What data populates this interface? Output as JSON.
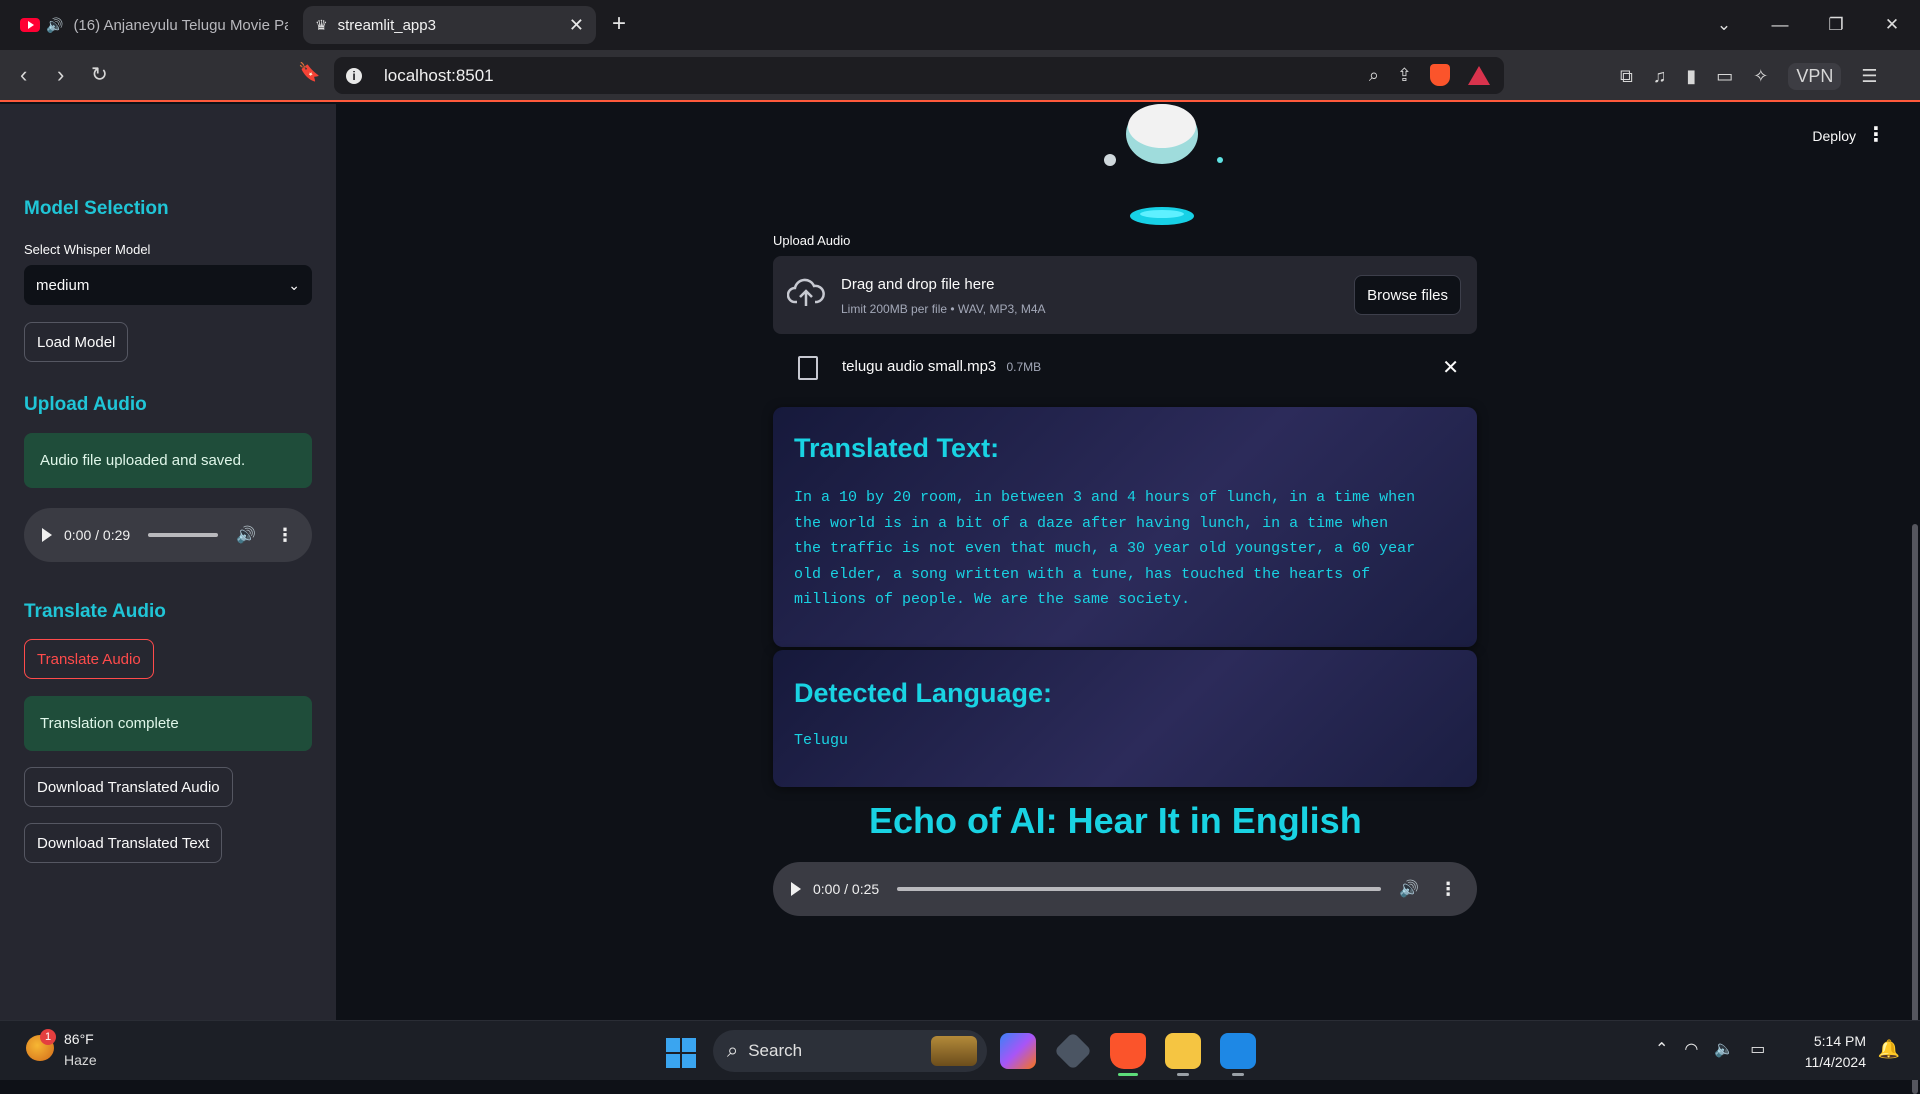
{
  "browser": {
    "tabs": [
      {
        "title": "(16) Anjaneyulu Telugu Movie Pa",
        "active": false,
        "icon": "youtube-icon"
      },
      {
        "title": "streamlit_app3",
        "active": true,
        "icon": "streamlit-crown-icon"
      }
    ],
    "url": "localhost:8501",
    "vpn_label": "VPN",
    "accent_color": "#ff5a3c"
  },
  "header": {
    "deploy_label": "Deploy"
  },
  "sidebar": {
    "model_section": {
      "heading": "Model Selection",
      "select_label": "Select Whisper Model",
      "selected_model": "medium",
      "load_button": "Load Model"
    },
    "upload_section": {
      "heading": "Upload Audio",
      "status": "Audio file uploaded and saved.",
      "player_time": "0:00 / 0:29"
    },
    "translate_section": {
      "heading": "Translate Audio",
      "translate_button": "Translate Audio",
      "status": "Translation complete",
      "download_audio_button": "Download Translated Audio",
      "download_text_button": "Download Translated Text"
    },
    "heading_color": "#20c5d6",
    "success_color": "#1f4d3a"
  },
  "main": {
    "upload": {
      "label": "Upload Audio",
      "dropzone_title": "Drag and drop file here",
      "dropzone_subtitle": "Limit 200MB per file • WAV, MP3, M4A",
      "browse_button": "Browse files",
      "file_name": "telugu audio small.mp3",
      "file_size": "0.7MB"
    },
    "translated": {
      "heading": "Translated Text:",
      "text": "In a 10 by 20 room, in between 3 and 4 hours of lunch, in a time when\nthe world is in a bit of a daze after having lunch, in a time when\nthe traffic is not even that much, a 30 year old youngster, a 60 year\nold elder, a song written with a tune, has touched the hearts of\nmillions of people. We are the same society."
    },
    "language": {
      "heading": "Detected Language:",
      "value": "Telugu"
    },
    "echo_title": "Echo of AI: Hear It in English",
    "player_time": "0:00 / 0:25",
    "accent_color": "#19d3e3"
  },
  "taskbar": {
    "weather_temp": "86°F",
    "weather_desc": "Haze",
    "weather_badge": "1",
    "search_label": "Search",
    "time": "5:14 PM",
    "date": "11/4/2024"
  }
}
